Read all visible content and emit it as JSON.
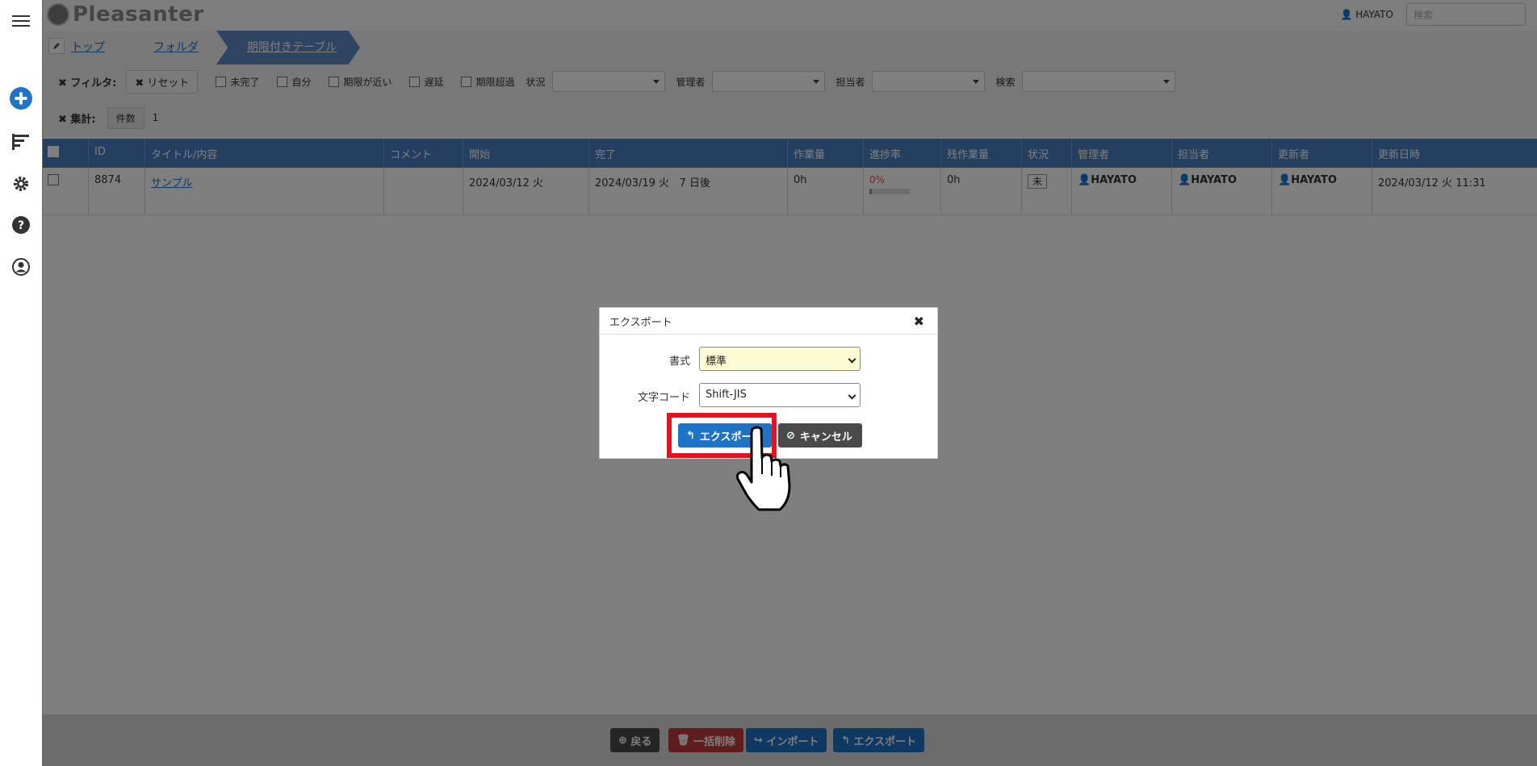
{
  "header": {
    "logo_text": "Pleasanter",
    "user_name": "HAYATO",
    "search_placeholder": "検索"
  },
  "leftbar": {
    "icons": [
      "menu-icon",
      "plus-circle-icon",
      "sort-icon",
      "gear-icon",
      "help-icon",
      "user-icon"
    ]
  },
  "breadcrumb": {
    "items": [
      "トップ",
      "フォルダ",
      "期限付きテーブル"
    ]
  },
  "filters": {
    "label": "フィルタ:",
    "reset": "リセット",
    "checks": [
      "未完了",
      "自分",
      "期限が近い",
      "遅延",
      "期限超過"
    ],
    "status_label": "状況",
    "manager_label": "管理者",
    "owner_label": "担当者",
    "search_label": "検索",
    "aggregate_label": "集計:",
    "count_label": "件数",
    "count_value": "1"
  },
  "grid": {
    "columns": [
      "ID",
      "タイトル/内容",
      "コメント",
      "開始",
      "完了",
      "作業量",
      "進捗率",
      "残作業量",
      "状況",
      "管理者",
      "担当者",
      "更新者",
      "更新日時"
    ],
    "row": {
      "id": "8874",
      "title": "サンプル",
      "comment": "",
      "start": "2024/03/12 火",
      "complete": "2024/03/19 火",
      "remaining_days": "7 日後",
      "work": "0h",
      "progress": "0%",
      "progress_value": 0,
      "remaining_work": "0h",
      "status": "未",
      "manager": "HAYATO",
      "owner": "HAYATO",
      "updater": "HAYATO",
      "updated": "2024/03/12 火 11:31"
    }
  },
  "footer": {
    "back": "戻る",
    "bulk_delete": "一括削除",
    "import": "インポート",
    "export": "エクスポート"
  },
  "dialog": {
    "title": "エクスポート",
    "format_label": "書式",
    "format_value": "標準",
    "encoding_label": "文字コード",
    "encoding_value": "Shift-JIS",
    "export_button": "エクスポート",
    "cancel_button": "キャンセル"
  },
  "colors": {
    "primary": "#1f73c6",
    "dark_button": "#4a4a4a",
    "highlight": "#e0141e",
    "format_bg": "#fdfbd3",
    "grid_header": "#497fc1"
  }
}
